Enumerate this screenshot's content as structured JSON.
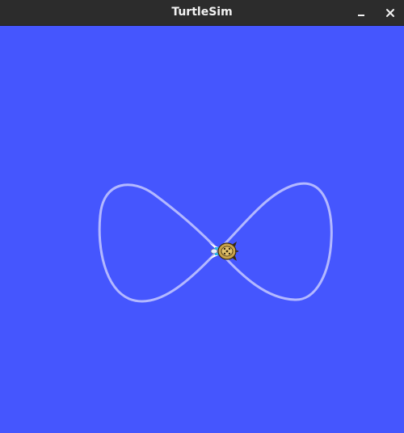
{
  "window": {
    "title": "TurtleSim",
    "minimize_icon": "minimize-icon",
    "close_icon": "close-icon"
  },
  "canvas": {
    "background_color": "#4556fe",
    "path_color": "#b3b8ff",
    "path_shape": "figure-eight",
    "turtle_icon": "turtle-icon"
  }
}
